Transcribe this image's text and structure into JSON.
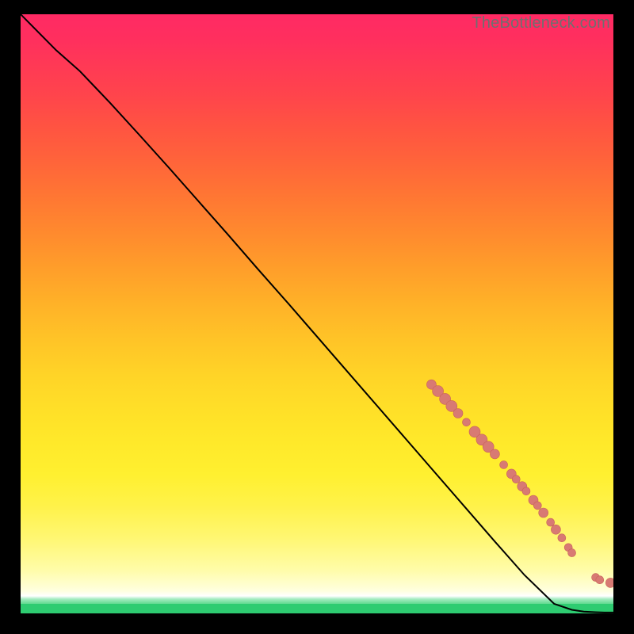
{
  "watermark": {
    "text": "TheBottleneck.com"
  },
  "colors": {
    "curve": "#000000",
    "marker_fill": "#d87a73",
    "marker_stroke": "#c8615a"
  },
  "chart_data": {
    "type": "line",
    "title": "",
    "xlabel": "",
    "ylabel": "",
    "xlim": [
      0,
      100
    ],
    "ylim": [
      0,
      100
    ],
    "grid": false,
    "series": [
      {
        "name": "curve",
        "x": [
          0,
          3,
          6,
          10,
          15,
          20,
          25,
          30,
          35,
          40,
          45,
          50,
          55,
          60,
          65,
          70,
          75,
          80,
          85,
          90,
          93,
          95,
          97,
          98.5,
          100
        ],
        "y": [
          100,
          97,
          94,
          90.5,
          85.3,
          79.9,
          74.4,
          68.8,
          63.2,
          57.5,
          51.9,
          46.2,
          40.5,
          34.8,
          29.1,
          23.4,
          17.7,
          12.0,
          6.4,
          1.6,
          0.6,
          0.3,
          0.2,
          0.15,
          0.15
        ]
      }
    ],
    "markers": [
      {
        "x": 69.3,
        "y": 38.2,
        "r": 6
      },
      {
        "x": 70.4,
        "y": 37.1,
        "r": 7
      },
      {
        "x": 71.6,
        "y": 35.8,
        "r": 7
      },
      {
        "x": 72.7,
        "y": 34.6,
        "r": 7
      },
      {
        "x": 73.8,
        "y": 33.4,
        "r": 6
      },
      {
        "x": 75.2,
        "y": 31.9,
        "r": 5
      },
      {
        "x": 76.6,
        "y": 30.3,
        "r": 7
      },
      {
        "x": 77.8,
        "y": 29.0,
        "r": 7
      },
      {
        "x": 78.9,
        "y": 27.8,
        "r": 7
      },
      {
        "x": 80.0,
        "y": 26.6,
        "r": 6
      },
      {
        "x": 81.5,
        "y": 24.8,
        "r": 5
      },
      {
        "x": 82.8,
        "y": 23.3,
        "r": 6
      },
      {
        "x": 83.6,
        "y": 22.4,
        "r": 5
      },
      {
        "x": 84.6,
        "y": 21.2,
        "r": 6
      },
      {
        "x": 85.3,
        "y": 20.4,
        "r": 5
      },
      {
        "x": 86.5,
        "y": 18.9,
        "r": 6
      },
      {
        "x": 87.2,
        "y": 18.0,
        "r": 5
      },
      {
        "x": 88.2,
        "y": 16.8,
        "r": 6
      },
      {
        "x": 89.4,
        "y": 15.2,
        "r": 5
      },
      {
        "x": 90.3,
        "y": 14.0,
        "r": 6
      },
      {
        "x": 91.3,
        "y": 12.6,
        "r": 5
      },
      {
        "x": 92.4,
        "y": 11.0,
        "r": 5
      },
      {
        "x": 93.0,
        "y": 10.1,
        "r": 5
      },
      {
        "x": 97.0,
        "y": 6.0,
        "r": 5
      },
      {
        "x": 97.7,
        "y": 5.6,
        "r": 5
      },
      {
        "x": 99.5,
        "y": 5.1,
        "r": 6
      }
    ]
  }
}
